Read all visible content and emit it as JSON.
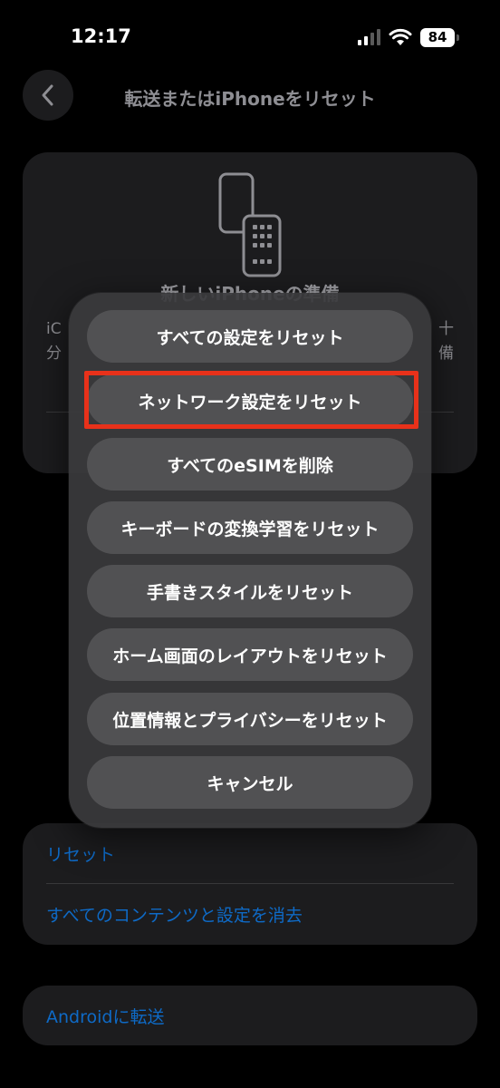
{
  "status_bar": {
    "time": "12:17",
    "battery_level": "84",
    "signal_bars_active": 2,
    "signal_bars_total": 4
  },
  "nav": {
    "back_icon": "chevron-left-icon",
    "title": "転送またはiPhoneをリセット"
  },
  "prepare_card": {
    "icon": "phones-icon",
    "title": "新しいiPhoneの準備",
    "left_fragment_line1": "iC",
    "left_fragment_line2": "分",
    "right_fragment_line1": "十",
    "right_fragment_line2": "備"
  },
  "action_sheet": {
    "buttons": [
      {
        "label": "すべての設定をリセット"
      },
      {
        "label": "ネットワーク設定をリセット",
        "highlighted": true
      },
      {
        "label": "すべてのeSIMを削除"
      },
      {
        "label": "キーボードの変換学習をリセット"
      },
      {
        "label": "手書きスタイルをリセット"
      },
      {
        "label": "ホーム画面のレイアウトをリセット"
      },
      {
        "label": "位置情報とプライバシーをリセット"
      },
      {
        "label": "キャンセル"
      }
    ],
    "highlight_color": "#e8311a"
  },
  "reset_list": {
    "items": [
      "リセット",
      "すべてのコンテンツと設定を消去"
    ]
  },
  "android": {
    "label": "Androidに転送"
  },
  "colors": {
    "accent": "#0a84ff",
    "background": "#000000",
    "sheet": "#3a3a3c"
  }
}
